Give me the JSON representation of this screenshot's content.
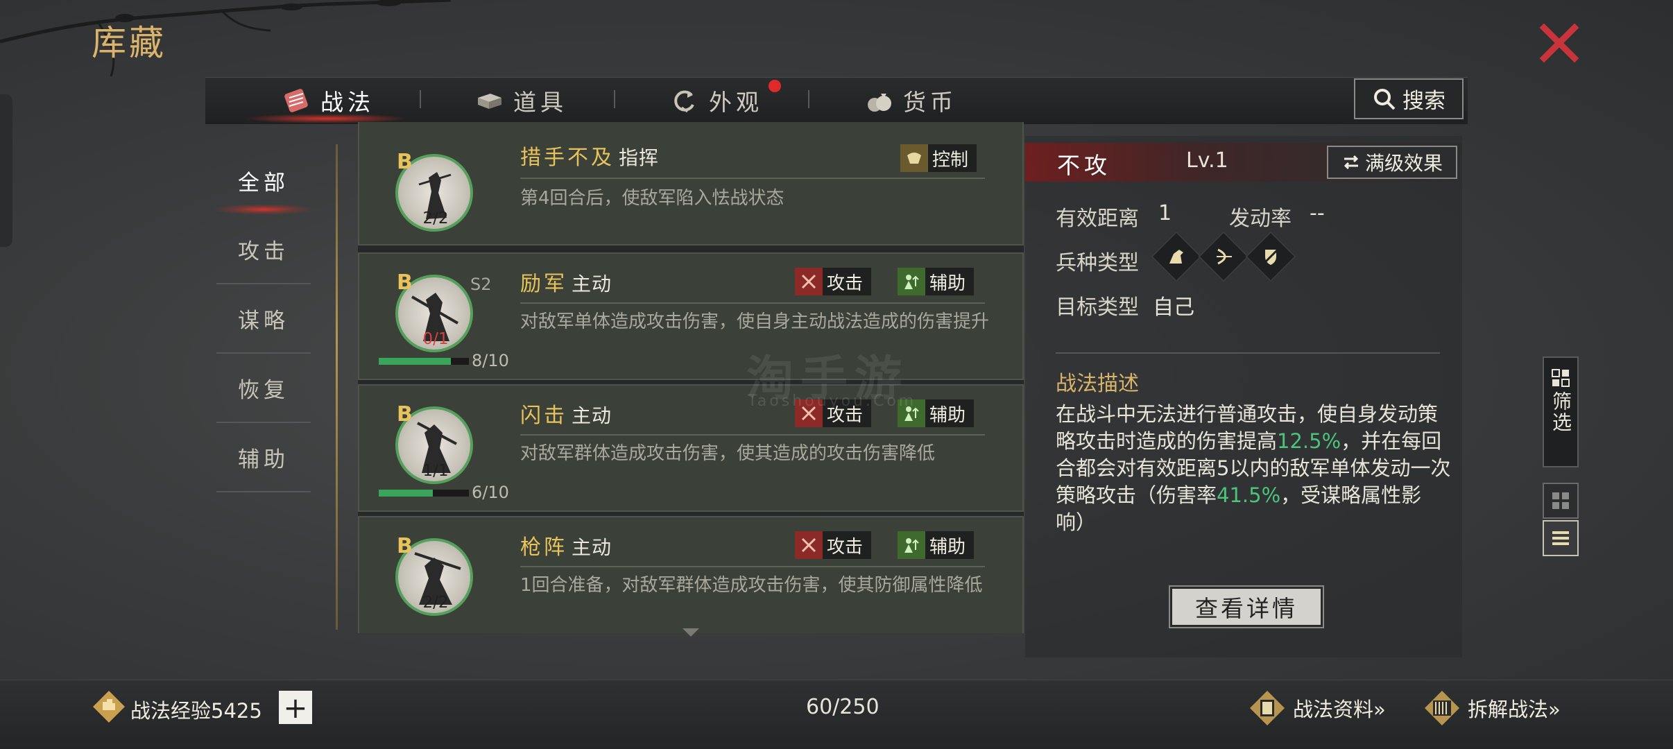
{
  "page": {
    "title": "库藏"
  },
  "tabs": [
    {
      "label": "战法",
      "active": true,
      "icon": "scroll-icon"
    },
    {
      "label": "道具",
      "active": false,
      "icon": "box-icon"
    },
    {
      "label": "外观",
      "active": false,
      "icon": "refresh-icon",
      "badge": true
    },
    {
      "label": "货币",
      "active": false,
      "icon": "money-bag-icon"
    }
  ],
  "search": {
    "label": "搜索"
  },
  "filters": [
    {
      "label": "全部",
      "active": true
    },
    {
      "label": "攻击",
      "active": false
    },
    {
      "label": "谋略",
      "active": false
    },
    {
      "label": "恢复",
      "active": false
    },
    {
      "label": "辅助",
      "active": false
    }
  ],
  "cards": [
    {
      "grade": "B",
      "count": "2/2",
      "name": "措手不及",
      "kind": "指挥",
      "tags": [
        {
          "label": "控制",
          "type": "control"
        }
      ],
      "desc": "第4回合后，使敌军陷入怯战状态"
    },
    {
      "grade": "B",
      "season": "S2",
      "count": "0/1",
      "progress_text": "8/10",
      "progress": 0.8,
      "name": "励军",
      "kind": "主动",
      "tags": [
        {
          "label": "攻击",
          "type": "attack"
        },
        {
          "label": "辅助",
          "type": "support"
        }
      ],
      "desc": "对敌军单体造成攻击伤害，使自身主动战法造成的伤害提升"
    },
    {
      "grade": "B",
      "count": "1/1",
      "progress_text": "6/10",
      "progress": 0.6,
      "name": "闪击",
      "kind": "主动",
      "tags": [
        {
          "label": "攻击",
          "type": "attack"
        },
        {
          "label": "辅助",
          "type": "support"
        }
      ],
      "desc": "对敌军群体造成攻击伤害，使其造成的攻击伤害降低"
    },
    {
      "grade": "B",
      "count": "2/2",
      "name": "枪阵",
      "kind": "主动",
      "tags": [
        {
          "label": "攻击",
          "type": "attack"
        },
        {
          "label": "辅助",
          "type": "support"
        }
      ],
      "desc": "1回合准备，对敌军群体造成攻击伤害，使其防御属性降低"
    }
  ],
  "detail": {
    "name": "不攻",
    "level": "Lv.1",
    "max_level_label": "满级效果",
    "range_label": "有效距离",
    "range_value": "1",
    "rate_label": "发动率",
    "rate_value": "--",
    "troop_label": "兵种类型",
    "troops": [
      "cavalry-icon",
      "archer-icon",
      "shield-icon"
    ],
    "target_label": "目标类型",
    "target_value": "自己",
    "desc_title": "战法描述",
    "desc_parts": [
      "在战斗中无法进行普通攻击，使自身发动策略攻击时造成的伤害提高",
      "12.5%",
      "，并在每回合都会对有效距离5以内的敌军单体发动一次策略攻击（伤害率",
      "41.5%",
      "，受谋略属性影响）"
    ],
    "view_details_label": "查看详情"
  },
  "side": {
    "filter_label": "筛选"
  },
  "bottom": {
    "exp_label": "战法经验",
    "exp_value": "5425",
    "plus": "+",
    "count": "60/250",
    "tactic_info": "战法资料»",
    "dismantle": "拆解战法»"
  },
  "watermark": {
    "cn": "淘手游",
    "en": "Taoshouyou.Com"
  },
  "colors": {
    "accent_gold": "#d9b46a",
    "accent_red": "#d0342c",
    "positive_green": "#4cc47a"
  }
}
